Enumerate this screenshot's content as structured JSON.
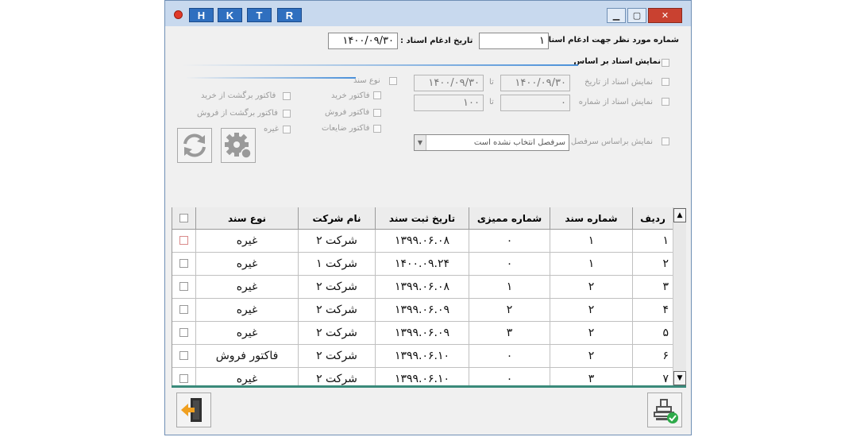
{
  "titlebar": {
    "buttons": [
      "H",
      "K",
      "T",
      "R"
    ]
  },
  "top": {
    "merge_label": "شماره مورد نظر جهت ادغام اسناد",
    "merge_value": "۱",
    "date_label": "تاریخ ادغام اسناد :",
    "date_value": "۱۴۰۰/۰۹/۳۰"
  },
  "show_by": {
    "label": "نمایش اسناد بر اساس",
    "from_date_label": "نمایش اسناد از تاریخ",
    "from_date": "۱۴۰۰/۰۹/۳۰",
    "to_label": "تا",
    "to_date": "۱۴۰۰/۰۹/۳۰",
    "from_num_label": "نمایش اسناد از شماره",
    "from_num": "۰",
    "to_num": "۱۰۰",
    "heading_label": "نمایش براساس سرفصل",
    "heading_value": "سرفصل انتخاب نشده است"
  },
  "doc_type": {
    "label": "نوع سند",
    "items": [
      "فاکتور خرید",
      "فاکتور فروش",
      "فاکتور ضایعات",
      "فاکتور برگشت از خرید",
      "فاکتور برگشت از فروش",
      "غیره"
    ]
  },
  "table": {
    "headers": [
      "ردیف",
      "شماره سند",
      "شماره ممیزی",
      "تاریخ ثبت سند",
      "نام شرکت",
      "نوع سند"
    ],
    "rows": [
      [
        "۱",
        "۱",
        "۰",
        "۱۳۹۹.۰۶.۰۸",
        "شرکت ۲",
        "غیره"
      ],
      [
        "۲",
        "۱",
        "۰",
        "۱۴۰۰.۰۹.۲۴",
        "شرکت ۱",
        "غیره"
      ],
      [
        "۳",
        "۲",
        "۱",
        "۱۳۹۹.۰۶.۰۸",
        "شرکت ۲",
        "غیره"
      ],
      [
        "۴",
        "۲",
        "۲",
        "۱۳۹۹.۰۶.۰۹",
        "شرکت ۲",
        "غیره"
      ],
      [
        "۵",
        "۲",
        "۳",
        "۱۳۹۹.۰۶.۰۹",
        "شرکت ۲",
        "غیره"
      ],
      [
        "۶",
        "۲",
        "۰",
        "۱۳۹۹.۰۶.۱۰",
        "شرکت ۲",
        "فاکتور فروش"
      ],
      [
        "۷",
        "۳",
        "۰",
        "۱۳۹۹.۰۶.۱۰",
        "شرکت ۲",
        "غیره"
      ]
    ]
  },
  "icons": {
    "refresh": "refresh-icon",
    "settings": "gear-icon",
    "exit": "exit-door-icon",
    "approve": "stamp-approve-icon"
  }
}
